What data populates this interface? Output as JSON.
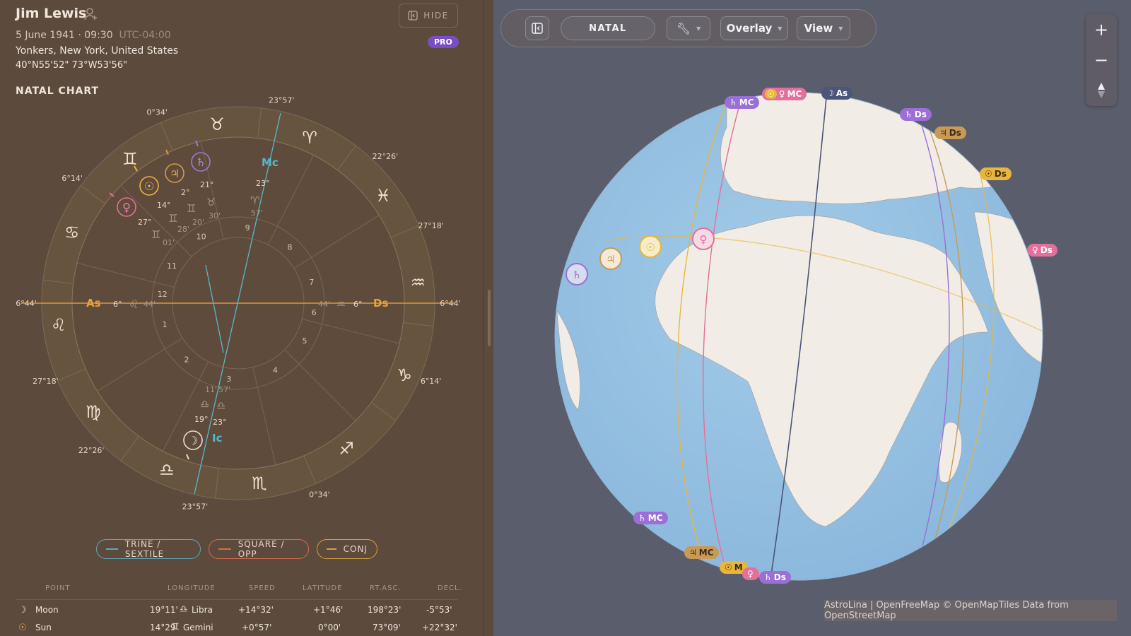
{
  "person": {
    "name": "Jim Lewis",
    "date_time": "5 June 1941 · 09:30",
    "tz": "UTC-04:00",
    "place": "Yonkers, New York, United States",
    "coords": "40°N55'52\" 73°W53'56\"",
    "hide_label": "HIDE",
    "badge": "PRO"
  },
  "chart": {
    "title": "NATAL CHART",
    "deg_labels": [
      "23°57'",
      "0°34'",
      "22°26'",
      "6°14'",
      "27°18'",
      "6°44'",
      "6°44'",
      "27°18'",
      "6°14'",
      "22°26'",
      "0°34'",
      "23°57'"
    ],
    "angles": {
      "as": "As",
      "ds": "Ds",
      "mc": "Mc",
      "ic": "Ic",
      "as_deg": "6°",
      "as_min": "44'",
      "ds_deg": "6°",
      "ds_min": "44'"
    },
    "houses": [
      "1",
      "2",
      "3",
      "4",
      "5",
      "6",
      "7",
      "8",
      "9",
      "10",
      "11",
      "12"
    ],
    "signs": [
      "♈",
      "♉",
      "♊",
      "♋",
      "♌",
      "♍",
      "♎",
      "♏",
      "♐",
      "♑",
      "♒",
      "♓"
    ],
    "planets": {
      "saturn": {
        "glyph": "♄",
        "deg": "21°",
        "min": "30'"
      },
      "jupiter": {
        "glyph": "♃",
        "deg": "2°",
        "min": "20'"
      },
      "sun": {
        "glyph": "☉",
        "deg": "14°",
        "min": "28'"
      },
      "venus": {
        "glyph": "♀",
        "deg": "27°",
        "min": "01'"
      },
      "mc": {
        "deg": "23°",
        "min": "57'"
      },
      "moon": {
        "glyph": "☽",
        "deg": "19°",
        "min": "11'"
      },
      "ic": {
        "deg": "23°",
        "min": "57'"
      }
    }
  },
  "legend": {
    "trine": "TRINE / SEXTILE",
    "square": "SQUARE / OPP",
    "conj": "CONJ"
  },
  "table": {
    "headers": [
      "POINT",
      "LONGITUDE",
      "SPEED",
      "LATITUDE",
      "RT.ASC.",
      "DECL."
    ],
    "rows": [
      {
        "glyph": "☽",
        "point": "Moon",
        "lon": "19°11'",
        "sign_glyph": "♎",
        "sign": "Libra",
        "speed": "+14°32'",
        "lat": "+1°46'",
        "ra": "198°23'",
        "decl": "-5°53'"
      },
      {
        "glyph": "☉",
        "point": "Sun",
        "lon": "14°29'",
        "sign_glyph": "♊",
        "sign": "Gemini",
        "speed": "+0°57'",
        "lat": "0°00'",
        "ra": "73°09'",
        "decl": "+22°32'"
      }
    ]
  },
  "toolbar": {
    "mode": "NATAL",
    "overlay": "Overlay",
    "view": "View"
  },
  "map": {
    "attribution": "AstroLina | OpenFreeMap © OpenMapTiles Data from OpenStreetMap",
    "tags": {
      "mc_sat_top": "MC",
      "mc_sun_ven_top": "MC",
      "as_moon": "As",
      "ds_sat": "Ds",
      "ds_jup": "Ds",
      "ds_sun": "Ds",
      "ds_ven": "Ds",
      "mc_sat_bot": "MC",
      "mc_jup_bot": "MC",
      "mc_sun_bot": "M",
      "ds_sat_bot": "Ds"
    },
    "colors": {
      "saturn": "#9b6fd6",
      "jupiter": "#c99a55",
      "sun": "#e8b63c",
      "venus": "#e46f9a",
      "moon": "#4b5577",
      "as_line": "#e0a64a"
    }
  }
}
